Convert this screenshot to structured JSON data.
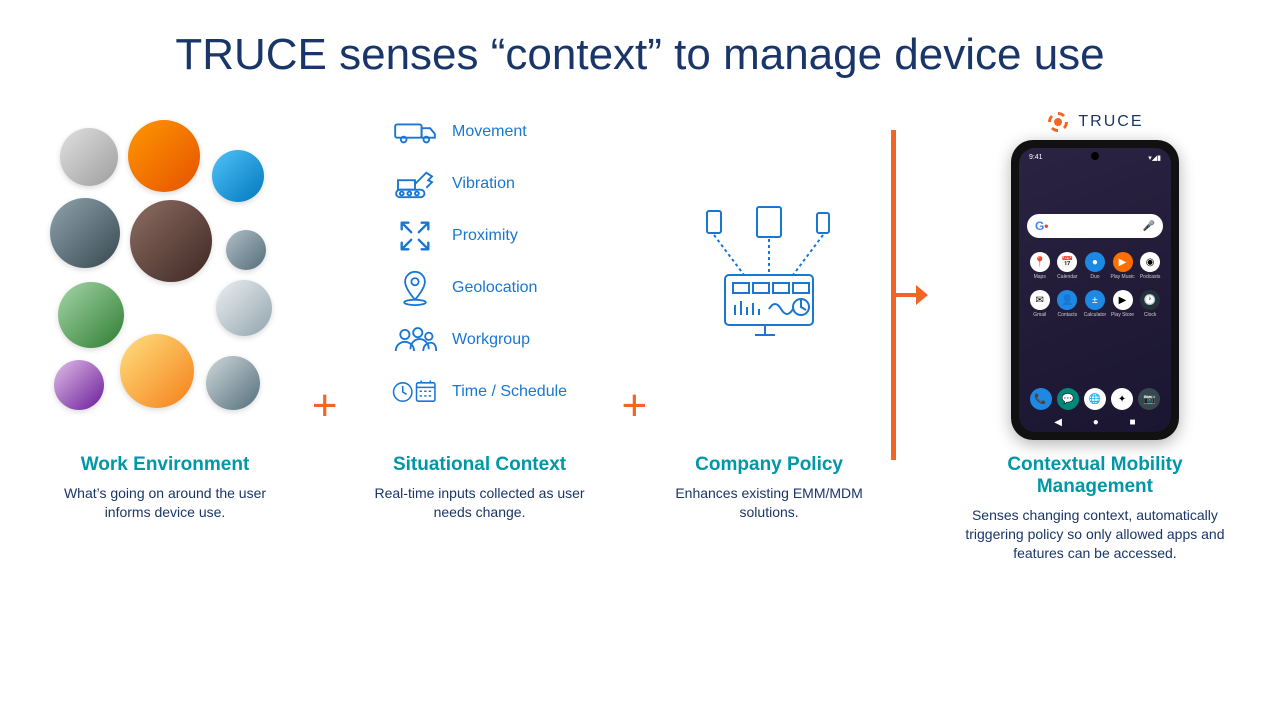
{
  "title": "TRUCE senses “context” to manage device use",
  "brand": "TRUCE",
  "columns": {
    "work_env": {
      "heading": "Work Environment",
      "desc": "What’s going on around the user informs device use."
    },
    "situational": {
      "heading": "Situational Context",
      "desc": "Real-time inputs collected as user needs change.",
      "items": [
        "Movement",
        "Vibration",
        "Proximity",
        "Geolocation",
        "Workgroup",
        "Time / Schedule"
      ]
    },
    "policy": {
      "heading": "Company Policy",
      "desc": "Enhances existing EMM/MDM solutions."
    },
    "cmm": {
      "heading": "Contextual Mobility Management",
      "desc": "Senses changing context, automatically triggering policy so only allowed apps and features can be accessed."
    }
  },
  "phone": {
    "time": "9:41",
    "apps_row1": [
      "Maps",
      "Calendar",
      "Duo",
      "Play Music",
      "Podcasts"
    ],
    "apps_row2": [
      "Gmail",
      "Contacts",
      "Calculator",
      "Play Store",
      "Clock"
    ]
  },
  "plus": "+",
  "colors": {
    "heading": "#1a3668",
    "accent": "#f26522",
    "link": "#1976d2",
    "teal": "#0097a7"
  }
}
